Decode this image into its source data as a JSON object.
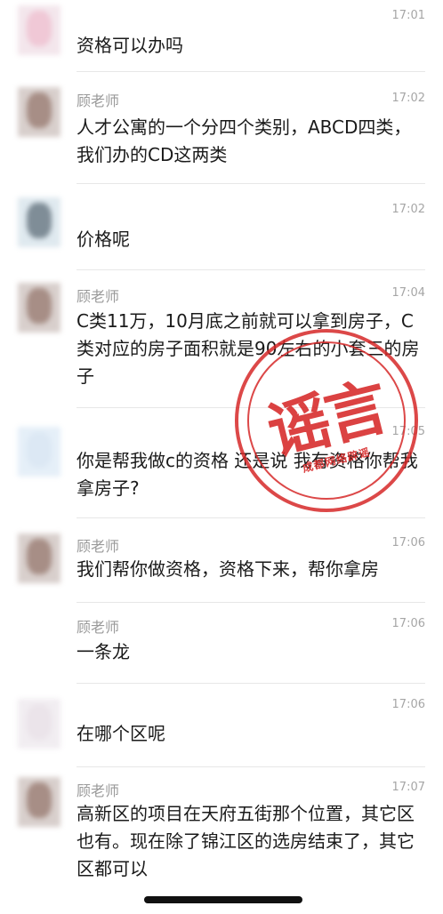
{
  "messages": [
    {
      "name": "",
      "time": "17:01",
      "text": "资格可以办吗"
    },
    {
      "name": "顾老师",
      "time": "17:02",
      "text": "人才公寓的一个分四个类别，ABCD四类，我们办的CD这两类"
    },
    {
      "name": "",
      "time": "17:02",
      "text": "价格呢"
    },
    {
      "name": "顾老师",
      "time": "17:04",
      "text": "C类11万，10月底之前就可以拿到房子，C类对应的房子面积就是90左右的小套三的房子"
    },
    {
      "name": "",
      "time": "17:05",
      "text": "你是帮我做c的资格 还是说 我有资格你帮我拿房子?"
    },
    {
      "name": "顾老师",
      "time": "17:06",
      "text": "我们帮你做资格，资格下来，帮你拿房"
    },
    {
      "name": "顾老师",
      "time": "17:06",
      "text": "一条龙"
    },
    {
      "name": "",
      "time": "17:06",
      "text": "在哪个区呢"
    },
    {
      "name": "顾老师",
      "time": "17:07",
      "text": "高新区的项目在天府五街那个位置，其它区也有。现在除了锦江区的选房结束了，其它区都可以"
    }
  ],
  "stamp": {
    "main": "谣言",
    "sub": "成都网络辟谣",
    "color": "#d62828"
  }
}
